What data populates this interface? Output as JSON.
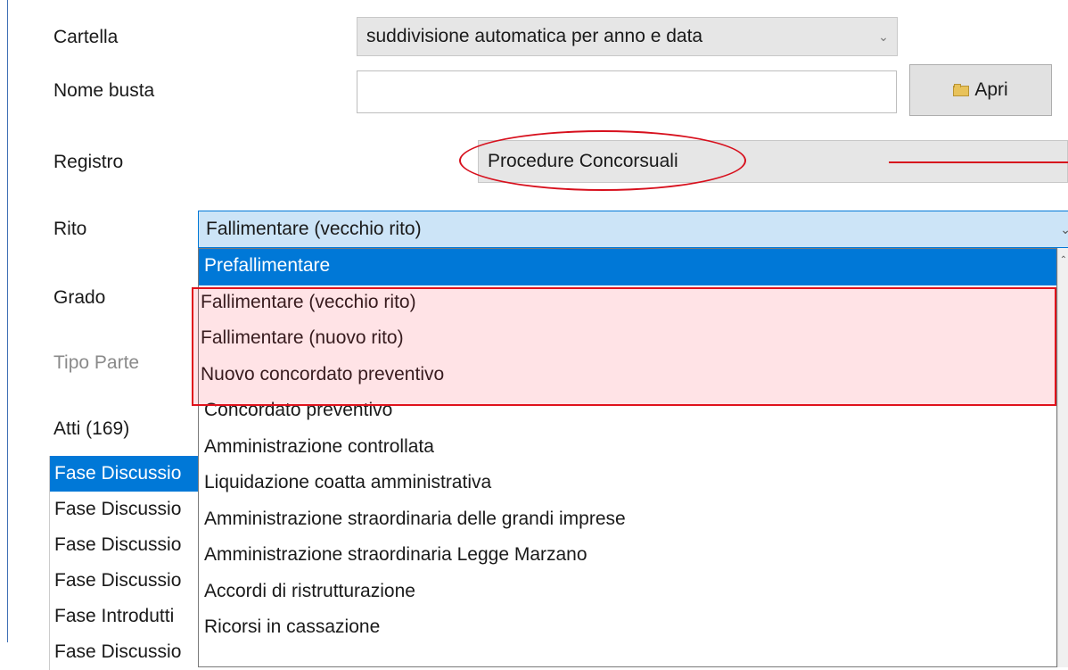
{
  "form": {
    "cartella_label": "Cartella",
    "cartella_value": "suddivisione automatica per anno e data",
    "nome_busta_label": "Nome busta",
    "nome_busta_value": "",
    "apri_label": "Apri",
    "registro_label": "Registro",
    "registro_value": "Procedure Concorsuali",
    "rito_label": "Rito",
    "rito_value": "Fallimentare (vecchio rito)",
    "grado_label": "Grado",
    "tipo_parte_label": "Tipo Parte",
    "atti_label": "Atti (169)"
  },
  "rito_options": [
    "Prefallimentare",
    "Fallimentare (vecchio rito)",
    "Fallimentare (nuovo rito)",
    "Nuovo concordato preventivo",
    "Concordato preventivo",
    "Amministrazione controllata",
    "Liquidazione coatta amministrativa",
    "Amministrazione straordinaria delle grandi imprese",
    "Amministrazione straordinaria Legge Marzano",
    "Accordi di ristrutturazione",
    "Ricorsi in cassazione"
  ],
  "rito_selected_index": 0,
  "atti_items": [
    "Fase Discussio",
    "Fase Discussio",
    "Fase Discussio",
    "Fase Discussio",
    "Fase Introdutti",
    "Fase Discussio"
  ],
  "atti_selected_index": 0,
  "colors": {
    "selection": "#0078d7",
    "annotation_red": "#e0121c"
  },
  "icons": {
    "dropdown_arrow": "chevron-down-icon",
    "apri": "folder-icon"
  }
}
